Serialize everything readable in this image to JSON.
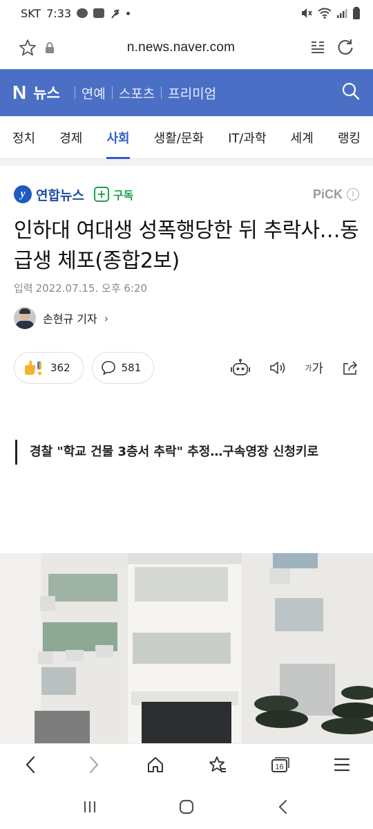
{
  "status": {
    "carrier": "SKT",
    "time": "7:33"
  },
  "browser": {
    "url": "n.news.naver.com"
  },
  "header": {
    "logo": "N",
    "brand": "뉴스",
    "sections": [
      "연예",
      "스포츠",
      "프리미엄"
    ]
  },
  "tabs": [
    "정치",
    "경제",
    "사회",
    "생활/문화",
    "IT/과학",
    "세계",
    "랭킹"
  ],
  "active_tab": "사회",
  "press": {
    "name": "연합뉴스",
    "subscribe": "구독",
    "pick": "PiCK",
    "info": "i"
  },
  "article": {
    "title": "인하대 여대생 성폭행당한 뒤 추락사…동급생 체포(종합2보)",
    "date_label": "입력",
    "date": "2022.07.15. 오후 6:20",
    "reporter": "손현규 기자",
    "likes": "362",
    "comments": "581",
    "subheadline": "경찰 \"학교 건물 3층서 추락\" 추정…구속영장 신청키로"
  },
  "tools": {
    "font_label_small": "가",
    "font_label_big": "가"
  },
  "bottom": {
    "tab_count": "16"
  },
  "colors": {
    "brand": "#4b6fc4",
    "active": "#2f5cc7",
    "subscribe": "#19a24a"
  }
}
